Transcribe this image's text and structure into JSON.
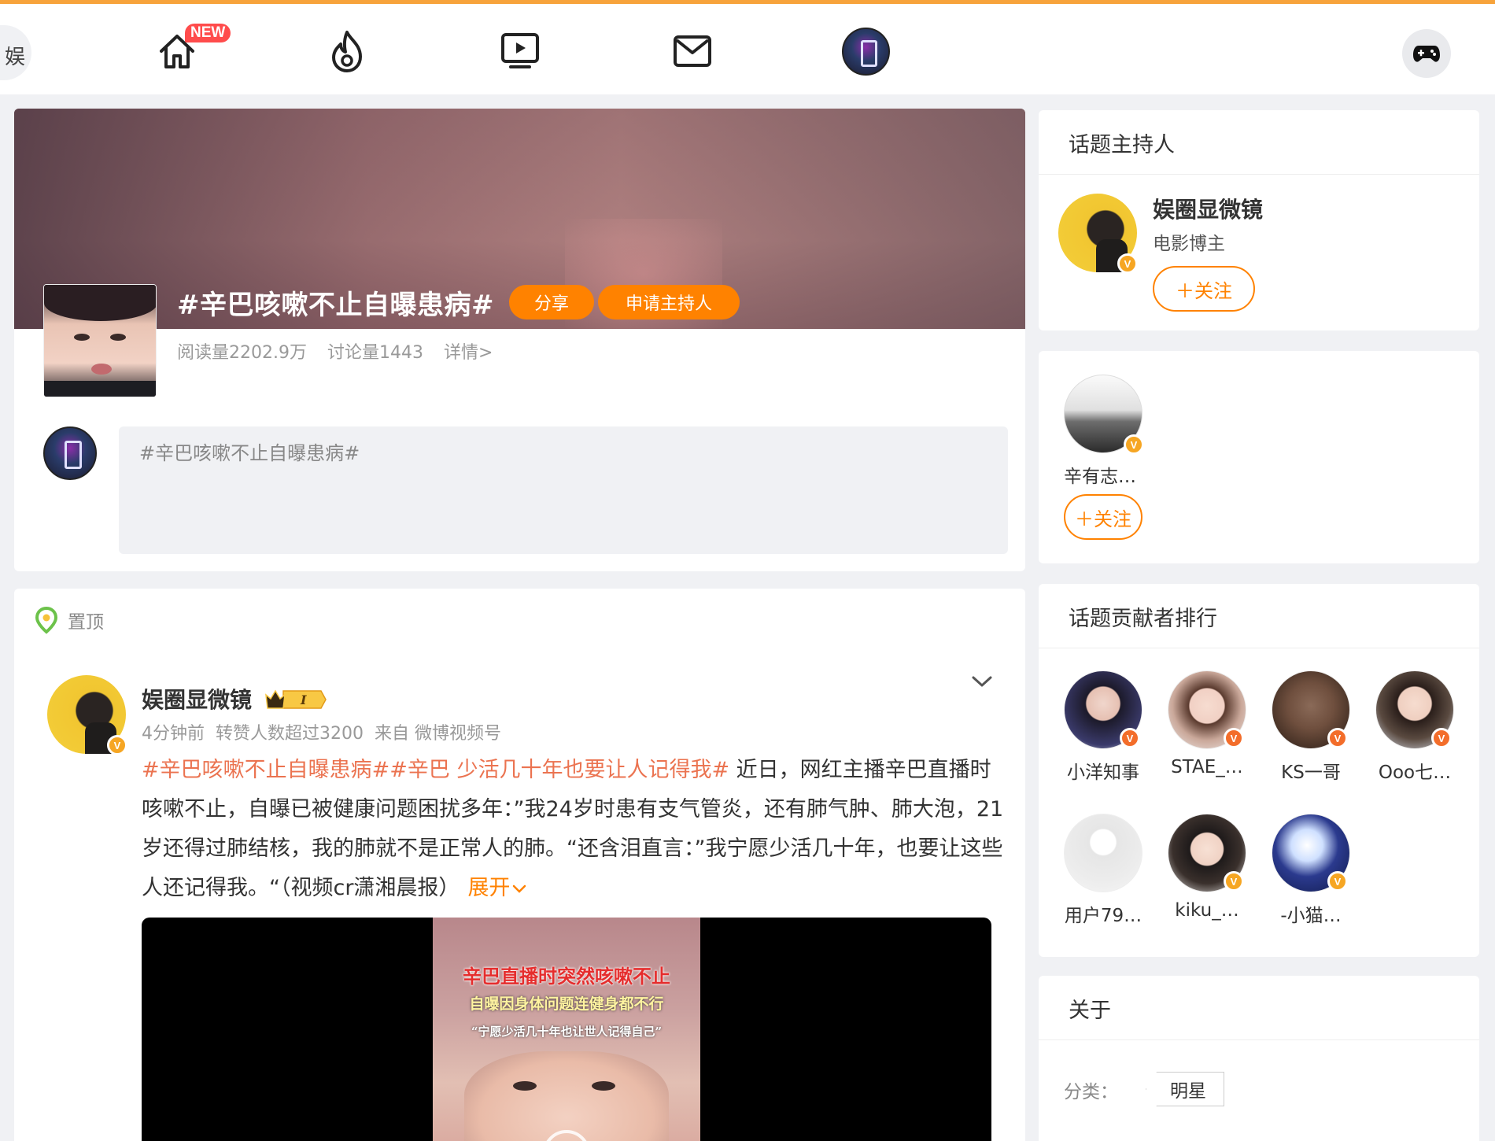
{
  "nav": {
    "side_text": "娱",
    "new_badge": "NEW"
  },
  "topic": {
    "title": "#辛巴咳嗽不止自曝患病#",
    "share_label": "分享",
    "apply_host_label": "申请主持人",
    "reads": "阅读量2202.9万",
    "discussions": "讨论量1443",
    "detail_link": "详情>",
    "composer_placeholder": "#辛巴咳嗽不止自曝患病#"
  },
  "post": {
    "pinned_label": "置顶",
    "author": "娱圈显微镜",
    "rank_level": "I",
    "time": "4分钟前",
    "reposts": "转赞人数超过3200",
    "source": "来自 微博视频号",
    "tag1": "#辛巴咳嗽不止自曝患病#",
    "tag2": "#辛巴 少活几十年也要让人记得我#",
    "body": " 近日，网红主播辛巴直播时咳嗽不止，自曝已被健康问题困扰多年：”我24岁时患有支气管炎，还有肺气肿、肺大泡，21岁还得过肺结核，我的肺就不是正常人的肺。“还含泪直言：”我宁愿少活几十年，也要让这些人还记得我。“（视频cr潇湘晨报）",
    "expand_label": "展开",
    "video_caption_1": "辛巴直播时突然咳嗽不止",
    "video_caption_2": "自曝因身体问题连健身都不行",
    "video_caption_3": "“宁愿少活几十年也让世人记得自己”"
  },
  "sidebar": {
    "host_section_title": "话题主持人",
    "host_name": "娱圈显微镜",
    "host_desc": "电影博主",
    "follow_label": "＋关注",
    "guest_name": "辛有志…",
    "contributors_title": "话题贡献者排行",
    "contributors": [
      {
        "name": "小洋知事"
      },
      {
        "name": "STAE_…"
      },
      {
        "name": "KS一哥"
      },
      {
        "name": "Ooo七…"
      },
      {
        "name": "用户79…"
      },
      {
        "name": "kiku_…"
      },
      {
        "name": "-小猫…"
      }
    ],
    "about_title": "关于",
    "category_label": "分类：",
    "category_value": "明星"
  },
  "colors": {
    "accent": "#ff8200",
    "tag": "#eb7350",
    "top_border": "#f7a33b",
    "verified": "#f6a623"
  },
  "icons": [
    "home-icon",
    "fire-icon",
    "video-icon",
    "mail-icon",
    "game-controller-icon",
    "location-pin-icon",
    "chevron-down-icon",
    "crown-icon",
    "verified-icon"
  ]
}
